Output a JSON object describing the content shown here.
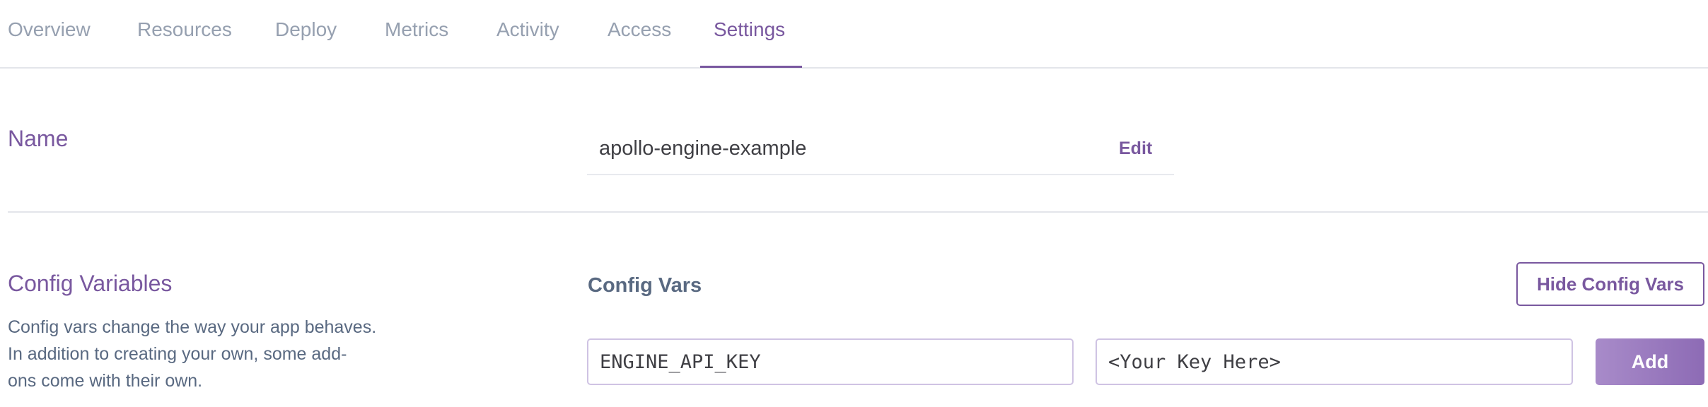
{
  "tabs": [
    {
      "label": "Overview",
      "active": false
    },
    {
      "label": "Resources",
      "active": false
    },
    {
      "label": "Deploy",
      "active": false
    },
    {
      "label": "Metrics",
      "active": false
    },
    {
      "label": "Activity",
      "active": false
    },
    {
      "label": "Access",
      "active": false
    },
    {
      "label": "Settings",
      "active": true
    }
  ],
  "name_section": {
    "title": "Name",
    "value": "apollo-engine-example",
    "edit_label": "Edit"
  },
  "config_section": {
    "title": "Config Variables",
    "description_lines": [
      "Config vars change the way your app behaves.",
      "In addition to creating your own, some add-",
      "ons come with their own."
    ],
    "vars_label": "Config Vars",
    "hide_button_label": "Hide Config Vars",
    "key_input_value": "ENGINE_API_KEY",
    "value_input_value": "<Your Key Here>",
    "add_button_label": "Add"
  },
  "colors": {
    "accent": "#79589f",
    "muted_tab": "#96a0b0",
    "body_text": "#596981",
    "divider": "#e3e5ea"
  }
}
